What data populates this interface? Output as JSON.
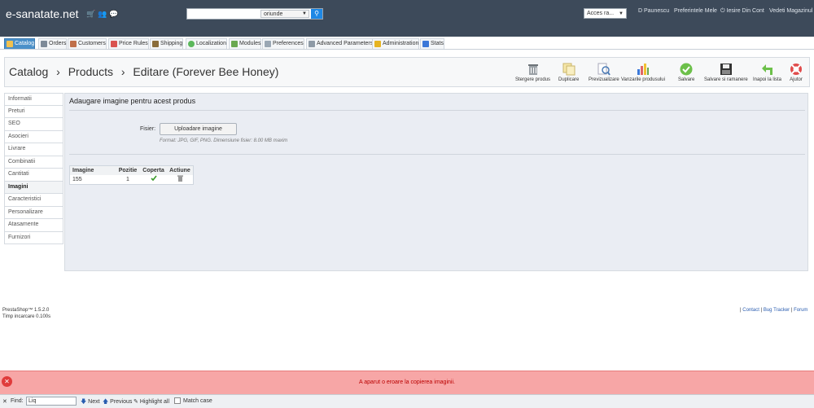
{
  "header": {
    "logo": "e-sanatate.net",
    "search": {
      "value": "",
      "select_value": "oriunde"
    },
    "access_select": "Acces ra...",
    "user": "D Paunescu",
    "links": [
      "Preferintele Mele",
      "Iesire Din Cont",
      "Vedeti Magazinul"
    ]
  },
  "tabs": [
    {
      "label": "Catalog",
      "color": "#f2c14e"
    },
    {
      "label": "Orders",
      "color": "#7d8a98"
    },
    {
      "label": "Customers",
      "color": "#c0704a"
    },
    {
      "label": "Price Rules",
      "color": "#d9534f"
    },
    {
      "label": "Shipping",
      "color": "#8a6d3b"
    },
    {
      "label": "Localization",
      "color": "#5cb85c"
    },
    {
      "label": "Modules",
      "color": "#6aa84f"
    },
    {
      "label": "Preferences",
      "color": "#9aa7b4"
    },
    {
      "label": "Advanced Parameters",
      "color": "#8e9aa6"
    },
    {
      "label": "Administration",
      "color": "#e6b422"
    },
    {
      "label": "Stats",
      "color": "#3c78d8"
    }
  ],
  "breadcrumb": {
    "part1": "Catalog",
    "sep": "›",
    "part2": "Products",
    "part3": "Editare (Forever Bee Honey)"
  },
  "toolbar": [
    {
      "label": "Stergere produs"
    },
    {
      "label": "Duplicare"
    },
    {
      "label": "Previzualizare"
    },
    {
      "label": "Vanzarile produsului"
    },
    {
      "label": "Salvare"
    },
    {
      "label": "Salvare si ramanere"
    },
    {
      "label": "Inapoi la lista"
    },
    {
      "label": "Ajutor"
    }
  ],
  "nav": [
    "Informatii",
    "Preturi",
    "SEO",
    "Asocieri",
    "Livrare",
    "Combinatii",
    "Cantitati",
    "Imagini",
    "Caracteristici",
    "Personalizare",
    "Atasamente",
    "Furnizori"
  ],
  "nav_active": "Imagini",
  "panel": {
    "title": "Adaugare imagine pentru acest produs",
    "file_label": "Fisier:",
    "upload_label": "Uploadare imagine",
    "hint": "Format: JPG, GIF, PNG. Dimensiune fisier: 8.00 MB maxim",
    "table": {
      "headers": [
        "Imagine",
        "Pozitie",
        "Coperta",
        "Actiune"
      ],
      "rows": [
        {
          "image": "155",
          "position": "1"
        }
      ]
    }
  },
  "footer": {
    "version": "PrestaShop™ 1.5.2.0",
    "load_time": "Timp incarcare 0.100s",
    "links": [
      "Contact",
      "Bug Tracker",
      "Forum"
    ]
  },
  "error": {
    "message": "A aparut o eroare la copierea imaginii."
  },
  "findbar": {
    "label": "Find:",
    "value": "Liq",
    "next": "Next",
    "previous": "Previous",
    "highlight": "Highlight all",
    "match_case": "Match case"
  }
}
